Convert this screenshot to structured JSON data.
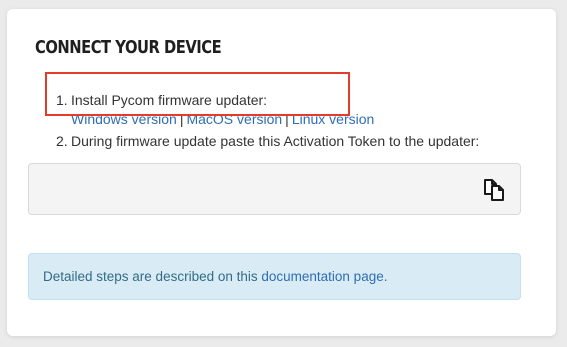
{
  "card": {
    "title": "Connect your device"
  },
  "steps": [
    {
      "number": "1.",
      "text": "Install Pycom firmware updater:",
      "links": [
        {
          "label": "Windows version"
        },
        {
          "label": "MacOS version"
        },
        {
          "label": "Linux version"
        }
      ],
      "separator": "|"
    },
    {
      "number": "2.",
      "text": "During firmware update paste this Activation Token to the updater:"
    }
  ],
  "token_box": {
    "value": "",
    "copy_icon": "copy-icon"
  },
  "info": {
    "prefix": "Detailed steps are described on this ",
    "link_label": "documentation page",
    "suffix": "."
  },
  "colors": {
    "link": "#2f6db5",
    "highlight": "#e53b2c",
    "info_bg": "#d9ecf5",
    "info_text": "#336b86"
  }
}
